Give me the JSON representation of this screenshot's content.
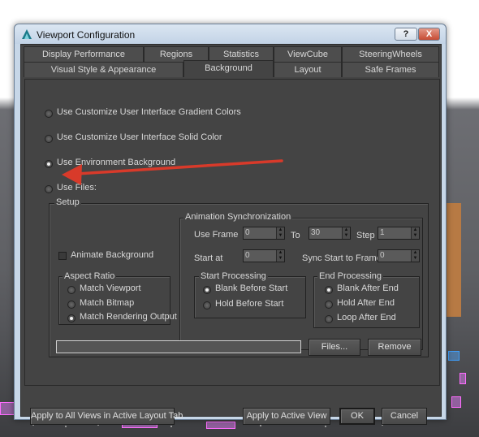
{
  "window": {
    "title": "Viewport Configuration",
    "help_label": "?",
    "close_label": "X"
  },
  "tabs_row1": [
    "Display Performance",
    "Regions",
    "Statistics",
    "ViewCube",
    "SteeringWheels"
  ],
  "tabs_row2": [
    "Visual Style & Appearance",
    "Background",
    "Layout",
    "Safe Frames"
  ],
  "active_tab": "Background",
  "background_options": [
    {
      "label": "Use Customize User Interface Gradient Colors",
      "selected": false
    },
    {
      "label": "Use Customize User Interface Solid Color",
      "selected": false
    },
    {
      "label": "Use Environment Background",
      "selected": true
    },
    {
      "label": "Use Files:",
      "selected": false
    }
  ],
  "setup": {
    "title": "Setup",
    "animate_background": {
      "label": "Animate Background",
      "checked": false
    },
    "aspect_ratio": {
      "title": "Aspect Ratio",
      "options": [
        {
          "label": "Match Viewport",
          "selected": false
        },
        {
          "label": "Match Bitmap",
          "selected": false
        },
        {
          "label": "Match Rendering Output",
          "selected": true
        }
      ]
    },
    "animation_sync": {
      "title": "Animation Synchronization",
      "use_frame_label": "Use Frame",
      "use_frame_value": "0",
      "to_label": "To",
      "to_value": "30",
      "step_label": "Step",
      "step_value": "1",
      "start_at_label": "Start at",
      "start_at_value": "0",
      "sync_start_label": "Sync Start to Frame",
      "sync_start_value": "0"
    },
    "start_processing": {
      "title": "Start Processing",
      "options": [
        {
          "label": "Blank Before Start",
          "selected": true
        },
        {
          "label": "Hold Before Start",
          "selected": false
        }
      ]
    },
    "end_processing": {
      "title": "End Processing",
      "options": [
        {
          "label": "Blank After End",
          "selected": true
        },
        {
          "label": "Hold After End",
          "selected": false
        },
        {
          "label": "Loop After End",
          "selected": false
        }
      ]
    },
    "file_path": "",
    "files_button": "Files...",
    "remove_button": "Remove"
  },
  "footer": {
    "apply_all": "Apply to All Views in Active Layout Tab",
    "apply_active": "Apply to Active View",
    "ok": "OK",
    "cancel": "Cancel"
  },
  "colors": {
    "annotation_arrow": "#d83a2a",
    "dialog_bg": "#444444",
    "scene_highlight": "#ff6cff"
  }
}
